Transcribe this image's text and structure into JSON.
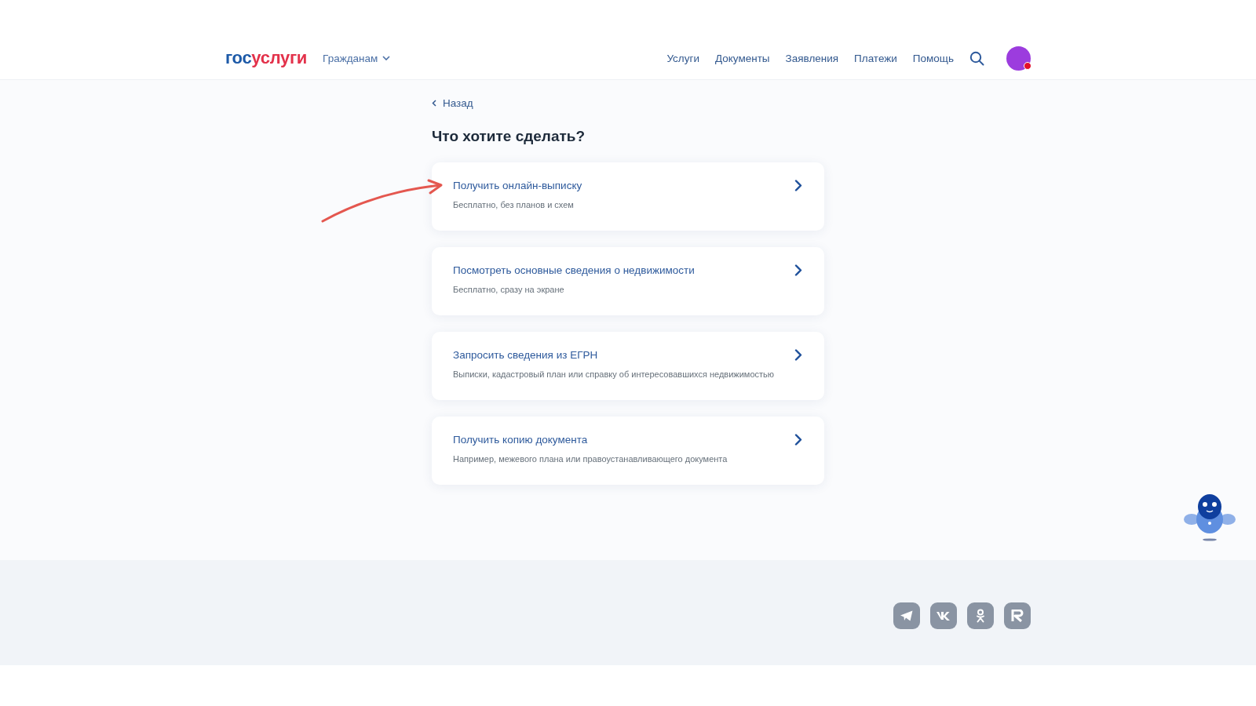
{
  "header": {
    "logo": {
      "first": "гос",
      "second": "услуги"
    },
    "audience_menu": "Гражданам",
    "nav": [
      "Услуги",
      "Документы",
      "Заявления",
      "Платежи",
      "Помощь"
    ],
    "avatar": {
      "notification": true
    }
  },
  "back_link": "Назад",
  "title": "Что хотите сделать?",
  "options": [
    {
      "title": "Получить онлайн-выписку",
      "subtitle": "Бесплатно, без планов и схем",
      "highlighted": true
    },
    {
      "title": "Посмотреть основные сведения о недвижимости",
      "subtitle": "Бесплатно, сразу на экране",
      "highlighted": false
    },
    {
      "title": "Запросить сведения из ЕГРН",
      "subtitle": "Выписки, кадастровый план или справку об интересовавшихся недвижимостью",
      "highlighted": false
    },
    {
      "title": "Получить копию документа",
      "subtitle": "Например, межевого плана или правоустанавливающего документа",
      "highlighted": false
    }
  ],
  "footer": {
    "social": [
      {
        "kind": "telegram"
      },
      {
        "kind": "vk"
      },
      {
        "kind": "ok"
      },
      {
        "kind": "rutube"
      }
    ]
  }
}
